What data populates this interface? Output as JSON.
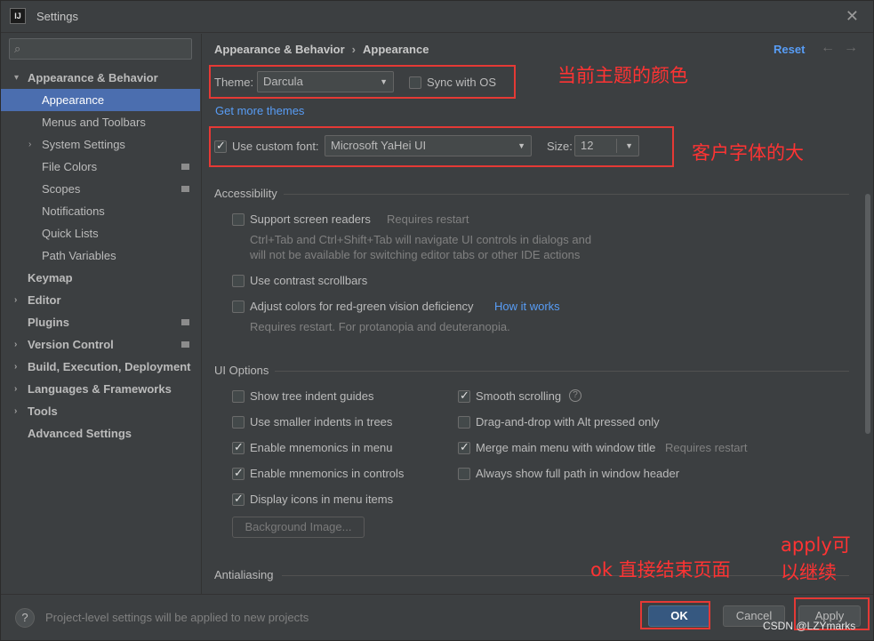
{
  "window": {
    "title": "Settings",
    "app_icon_text": "IJ"
  },
  "search": {
    "placeholder": ""
  },
  "sidebar": {
    "items": [
      {
        "label": "Appearance & Behavior",
        "indent": 0,
        "arrow": "▾",
        "bold": true,
        "selected": false,
        "badge": false
      },
      {
        "label": "Appearance",
        "indent": 1,
        "arrow": "",
        "bold": false,
        "selected": true,
        "badge": false
      },
      {
        "label": "Menus and Toolbars",
        "indent": 1,
        "arrow": "",
        "bold": false,
        "selected": false,
        "badge": false
      },
      {
        "label": "System Settings",
        "indent": 1,
        "arrow": "›",
        "bold": false,
        "selected": false,
        "badge": false
      },
      {
        "label": "File Colors",
        "indent": 1,
        "arrow": "",
        "bold": false,
        "selected": false,
        "badge": true
      },
      {
        "label": "Scopes",
        "indent": 1,
        "arrow": "",
        "bold": false,
        "selected": false,
        "badge": true
      },
      {
        "label": "Notifications",
        "indent": 1,
        "arrow": "",
        "bold": false,
        "selected": false,
        "badge": false
      },
      {
        "label": "Quick Lists",
        "indent": 1,
        "arrow": "",
        "bold": false,
        "selected": false,
        "badge": false
      },
      {
        "label": "Path Variables",
        "indent": 1,
        "arrow": "",
        "bold": false,
        "selected": false,
        "badge": false
      },
      {
        "label": "Keymap",
        "indent": 0,
        "arrow": "",
        "bold": true,
        "selected": false,
        "badge": false
      },
      {
        "label": "Editor",
        "indent": 0,
        "arrow": "›",
        "bold": true,
        "selected": false,
        "badge": false
      },
      {
        "label": "Plugins",
        "indent": 0,
        "arrow": "",
        "bold": true,
        "selected": false,
        "badge": true
      },
      {
        "label": "Version Control",
        "indent": 0,
        "arrow": "›",
        "bold": true,
        "selected": false,
        "badge": true
      },
      {
        "label": "Build, Execution, Deployment",
        "indent": 0,
        "arrow": "›",
        "bold": true,
        "selected": false,
        "badge": false
      },
      {
        "label": "Languages & Frameworks",
        "indent": 0,
        "arrow": "›",
        "bold": true,
        "selected": false,
        "badge": false
      },
      {
        "label": "Tools",
        "indent": 0,
        "arrow": "›",
        "bold": true,
        "selected": false,
        "badge": false
      },
      {
        "label": "Advanced Settings",
        "indent": 0,
        "arrow": "",
        "bold": true,
        "selected": false,
        "badge": false
      }
    ]
  },
  "header": {
    "breadcrumb_parent": "Appearance & Behavior",
    "breadcrumb_sep": "›",
    "breadcrumb_current": "Appearance",
    "reset_label": "Reset",
    "back_arrow": "←",
    "forward_arrow": "→"
  },
  "theme": {
    "label": "Theme:",
    "value": "Darcula",
    "sync_label": "Sync with OS",
    "sync_checked": false,
    "get_more_link": "Get more themes"
  },
  "font": {
    "use_custom_label": "Use custom font:",
    "use_custom_checked": true,
    "font_value": "Microsoft YaHei UI",
    "size_label": "Size:",
    "size_value": "12"
  },
  "accessibility": {
    "title": "Accessibility",
    "screen_readers_label": "Support screen readers",
    "screen_readers_hint": "Requires restart",
    "screen_readers_desc_1": "Ctrl+Tab and Ctrl+Shift+Tab will navigate UI controls in dialogs and",
    "screen_readers_desc_2": "will not be available for switching editor tabs or other IDE actions",
    "contrast_label": "Use contrast scrollbars",
    "colors_label": "Adjust colors for red-green vision deficiency",
    "how_it_works": "How it works",
    "colors_hint": "Requires restart. For protanopia and deuteranopia."
  },
  "ui_options": {
    "title": "UI Options",
    "left": [
      {
        "label": "Show tree indent guides",
        "checked": false
      },
      {
        "label": "Use smaller indents in trees",
        "checked": false
      },
      {
        "label": "Enable mnemonics in menu",
        "checked": true
      },
      {
        "label": "Enable mnemonics in controls",
        "checked": true
      },
      {
        "label": "Display icons in menu items",
        "checked": true
      }
    ],
    "right": [
      {
        "label": "Smooth scrolling",
        "checked": true
      },
      {
        "label": "Drag-and-drop with Alt pressed only",
        "checked": false
      },
      {
        "label": "Merge main menu with window title",
        "checked": true
      },
      {
        "label": "Always show full path in window header",
        "checked": false
      }
    ],
    "merge_hint": "Requires restart",
    "help_glyph": "?",
    "background_image_button": "Background Image..."
  },
  "antialiasing": {
    "title": "Antialiasing"
  },
  "footer": {
    "help_glyph": "?",
    "info_text": "Project-level settings will be applied to new projects",
    "ok_label": "OK",
    "cancel_label": "Cancel",
    "apply_label": "Apply"
  },
  "annotations": {
    "theme_note": "当前主题的颜色",
    "font_note": "客户字体的大",
    "ok_note": "ok 直接结束页面",
    "apply_note_1": "apply可",
    "apply_note_2": "以继续"
  },
  "watermark": "CSDN @LZYmarks",
  "colors": {
    "selection": "#4b6eaf",
    "link": "#589df6",
    "primary_button": "#365880",
    "annotation_red": "#e53935",
    "background": "#3c3f41"
  }
}
